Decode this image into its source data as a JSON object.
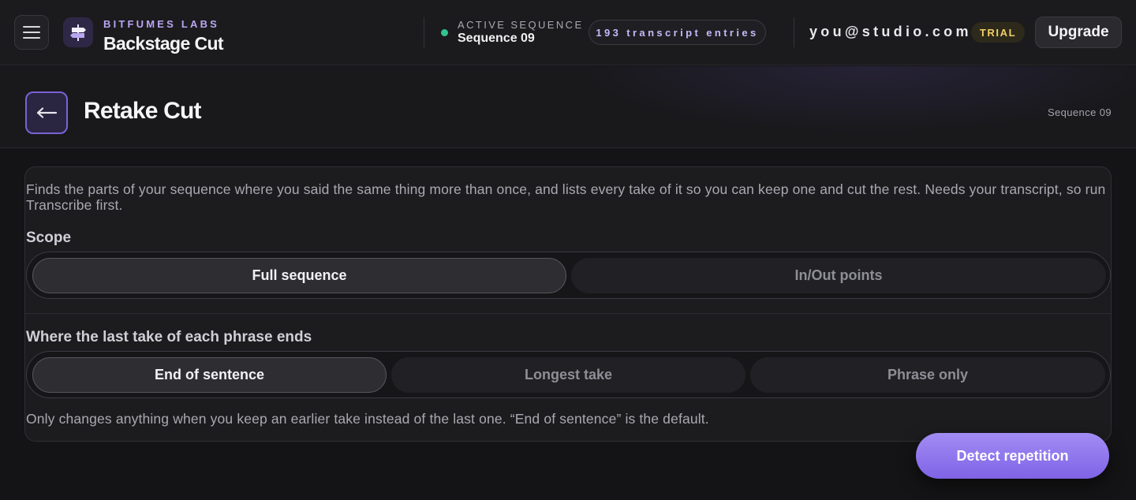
{
  "topbar": {
    "menu_icon": "hamburger-menu-icon",
    "logo_icon": "signpost-logo-icon",
    "brand_kicker": "BITFUMES LABS",
    "brand_title": "Backstage Cut",
    "active_sequence_label": "ACTIVE SEQUENCE",
    "active_sequence_value": "Sequence 09",
    "status_color": "#34c38f",
    "transcript_entries": "193 transcript entries",
    "user_email": "you@studio.com",
    "plan_badge": "TRIAL",
    "upgrade_label": "Upgrade"
  },
  "page": {
    "back_icon": "arrow-left-icon",
    "title": "Retake Cut",
    "sequence_label": "Sequence 09"
  },
  "card": {
    "description": "Finds the parts of your sequence where you said the same thing more than once, and lists every take of it so you can keep one and cut the rest. Needs your transcript, so run Transcribe first.",
    "scope": {
      "label": "Scope",
      "options": [
        "Full sequence",
        "In/Out points"
      ],
      "selected": "Full sequence"
    },
    "ending": {
      "label": "Where the last take of each phrase ends",
      "options": [
        "End of sentence",
        "Longest take",
        "Phrase only"
      ],
      "selected": "End of sentence"
    },
    "hint": "Only changes anything when you keep an earlier take instead of the last one. “End of sentence” is the default."
  },
  "actions": {
    "detect_label": "Detect repetition",
    "accent_color": "#8f75ee"
  }
}
